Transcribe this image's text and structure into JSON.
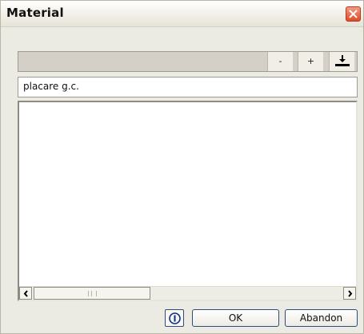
{
  "window": {
    "title": "Material"
  },
  "toolbar": {
    "minus_label": "-",
    "plus_label": "+",
    "download_icon": "download-icon"
  },
  "input": {
    "value": "placare g.c."
  },
  "list": {
    "items": []
  },
  "scrollbar": {
    "left_icon": "chevron-left-icon",
    "right_icon": "chevron-right-icon"
  },
  "buttons": {
    "info_icon": "info-icon",
    "ok_label": "OK",
    "cancel_label": "Abandon"
  },
  "colors": {
    "close_button": "#df4a24",
    "button_border": "#2d4c7a",
    "window_bg": "#ebeae3"
  }
}
